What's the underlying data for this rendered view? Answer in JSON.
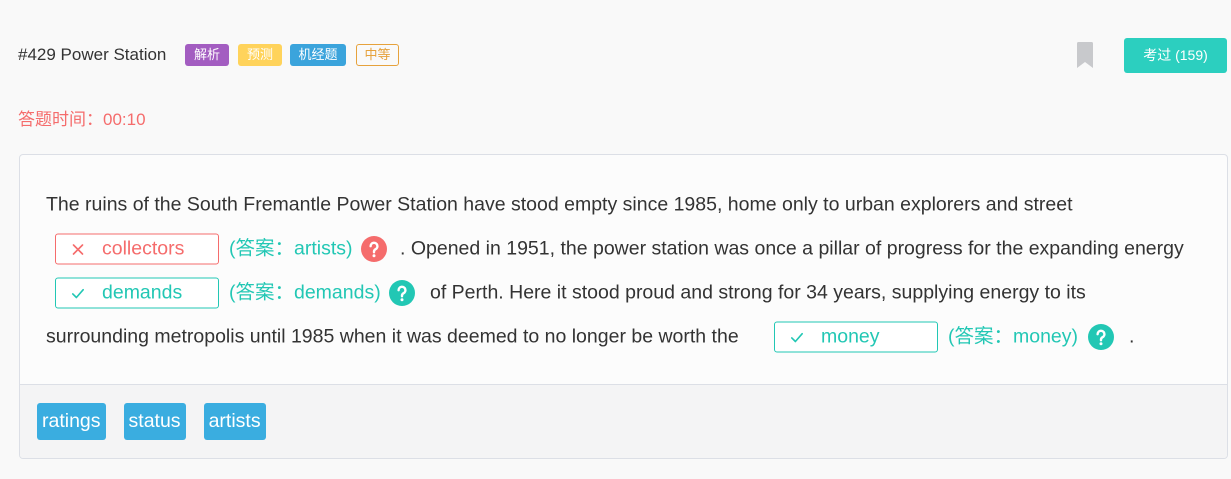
{
  "theme": {
    "accent": "#2ccfbf",
    "correct": "#22c7b4",
    "wrong": "#f56c6c",
    "word_chip": "#3aade0"
  },
  "header": {
    "title": "#429 Power Station",
    "tags": [
      {
        "label": "解析",
        "color": "#a35dc1"
      },
      {
        "label": "预测",
        "color": "#ffd35b"
      },
      {
        "label": "机经题",
        "color": "#3ba4dc"
      },
      {
        "label": "中等",
        "color": "#e6a23c"
      }
    ],
    "bookmark_icon": "bookmark-icon",
    "attempted_button": "考过 (159)"
  },
  "timer": {
    "label": "答题时间：",
    "value": "00:10"
  },
  "passage": {
    "text_1": "The ruins of the South Fremantle Power Station have stood empty since 1985, home only to urban explorers and street",
    "text_2": ". Opened in 1951, the power station was once a pillar of progress for the expanding energy",
    "text_3": "of Perth. Here it stood proud and strong for 34 years, supplying energy to its",
    "text_4": "surrounding metropolis until 1985 when it was deemed to no longer be worth the",
    "text_5": ".",
    "blanks": [
      {
        "value": "collectors",
        "correct": false,
        "result_icon": "cross-icon",
        "answer": "(答案：artists)",
        "help_icon": "question-circle-icon"
      },
      {
        "value": "demands",
        "correct": true,
        "result_icon": "check-icon",
        "answer": "(答案：demands)",
        "help_icon": "question-circle-icon"
      },
      {
        "value": "money",
        "correct": true,
        "result_icon": "check-icon",
        "answer": "(答案：money)",
        "help_icon": "question-circle-icon"
      }
    ]
  },
  "word_bank": {
    "options": [
      "ratings",
      "status",
      "artists"
    ]
  }
}
